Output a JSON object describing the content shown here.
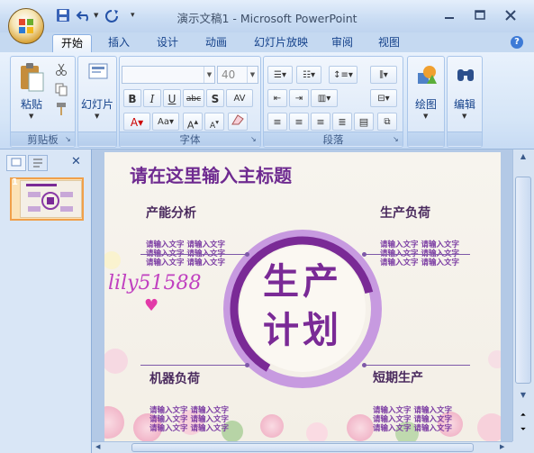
{
  "window": {
    "title": "演示文稿1 - Microsoft PowerPoint"
  },
  "quick_access": {
    "icons": [
      "save-icon",
      "undo-icon",
      "redo-icon",
      "customize-icon"
    ]
  },
  "tabs": [
    {
      "label": "开始",
      "active": true
    },
    {
      "label": "插入"
    },
    {
      "label": "设计"
    },
    {
      "label": "动画"
    },
    {
      "label": "幻灯片放映"
    },
    {
      "label": "审阅"
    },
    {
      "label": "视图"
    }
  ],
  "ribbon": {
    "clipboard": {
      "paste_label": "粘贴",
      "group_label": "剪贴板"
    },
    "slides": {
      "new_slide_label": "幻灯片"
    },
    "font": {
      "size_value": "40",
      "group_label": "字体"
    },
    "paragraph": {
      "group_label": "段落"
    },
    "drawing": {
      "label": "绘图"
    },
    "editing": {
      "label": "编辑"
    }
  },
  "slide": {
    "title": "请在这里输入主标题",
    "center": [
      "生产",
      "计划"
    ],
    "sections": [
      {
        "title": "产能分析",
        "lines": [
          "请输入文字 请输入文字",
          "请输入文字 请输入文字",
          "请输入文字 请输入文字"
        ]
      },
      {
        "title": "生产负荷",
        "lines": [
          "请输入文字 请输入文字",
          "请输入文字 请输入文字",
          "请输入文字 请输入文字"
        ]
      },
      {
        "title": "机器负荷",
        "lines": [
          "请输入文字 请输入文字",
          "请输入文字 请输入文字",
          "请输入文字 请输入文字"
        ]
      },
      {
        "title": "短期生产",
        "lines": [
          "请输入文字 请输入文字",
          "请输入文字 请输入文字",
          "请输入文字 请输入文字"
        ]
      }
    ],
    "watermark": "lily51588"
  },
  "slide_panel": {
    "thumbnail_number": "1"
  },
  "colors": {
    "accent_purple": "#7a2a96",
    "ribbon_blue": "#15428b"
  }
}
